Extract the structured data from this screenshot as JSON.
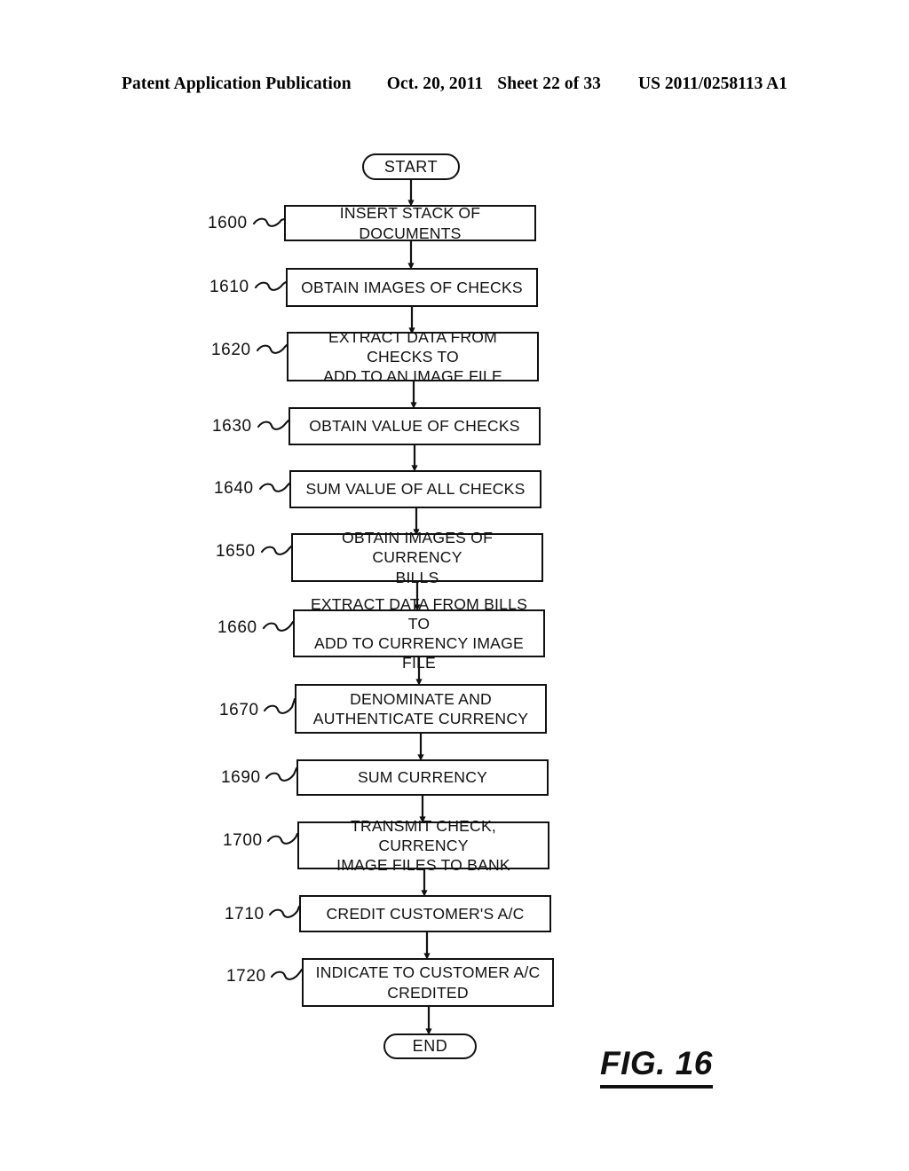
{
  "header": {
    "publication": "Patent Application Publication",
    "date": "Oct. 20, 2011",
    "sheet": "Sheet 22 of 33",
    "patent_number": "US 2011/0258113 A1"
  },
  "figure": {
    "caption": "FIG. 16"
  },
  "flowchart": {
    "start_label": "START",
    "end_label": "END",
    "steps": [
      {
        "ref": "1600",
        "line1": "INSERT STACK OF DOCUMENTS",
        "line2": ""
      },
      {
        "ref": "1610",
        "line1": "OBTAIN IMAGES OF CHECKS",
        "line2": ""
      },
      {
        "ref": "1620",
        "line1": "EXTRACT DATA FROM CHECKS TO",
        "line2": "ADD TO AN IMAGE FILE"
      },
      {
        "ref": "1630",
        "line1": "OBTAIN VALUE OF CHECKS",
        "line2": ""
      },
      {
        "ref": "1640",
        "line1": "SUM VALUE OF ALL CHECKS",
        "line2": ""
      },
      {
        "ref": "1650",
        "line1": "OBTAIN IMAGES OF CURRENCY",
        "line2": "BILLS"
      },
      {
        "ref": "1660",
        "line1": "EXTRACT DATA FROM BILLS TO",
        "line2": "ADD TO CURRENCY IMAGE FILE"
      },
      {
        "ref": "1670",
        "line1": "DENOMINATE AND",
        "line2": "AUTHENTICATE CURRENCY"
      },
      {
        "ref": "1690",
        "line1": "SUM CURRENCY",
        "line2": ""
      },
      {
        "ref": "1700",
        "line1": "TRANSMIT CHECK, CURRENCY",
        "line2": "IMAGE FILES TO BANK"
      },
      {
        "ref": "1710",
        "line1": "CREDIT CUSTOMER'S A/C",
        "line2": ""
      },
      {
        "ref": "1720",
        "line1": "INDICATE TO CUSTOMER A/C",
        "line2": "CREDITED"
      }
    ]
  },
  "colors": {
    "ink": "#111111",
    "paper": "#ffffff"
  }
}
